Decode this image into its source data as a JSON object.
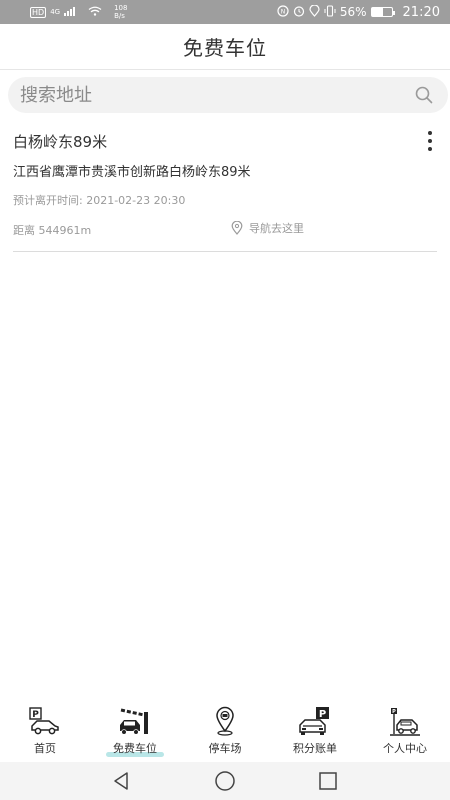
{
  "status_bar": {
    "hd": "HD",
    "network": "4G",
    "speed_value": "108",
    "speed_unit": "B/s",
    "battery": "56%",
    "battery_level": 0.56,
    "time": "21:20"
  },
  "header": {
    "title": "免费车位"
  },
  "search": {
    "placeholder": "搜索地址"
  },
  "card": {
    "title": "白杨岭东89米",
    "address": "江西省鹰潭市贵溪市创新路白杨岭东89米",
    "leave_time": "预计离开时间: 2021-02-23 20:30",
    "distance": "距离  544961m",
    "nav_label": "导航去这里"
  },
  "tabs": [
    {
      "label": "首页",
      "icon": "parking-car-icon"
    },
    {
      "label": "免费车位",
      "icon": "car-barrier-icon",
      "active": true
    },
    {
      "label": "停车场",
      "icon": "map-pin-icon"
    },
    {
      "label": "积分账单",
      "icon": "car-parking-bill-icon"
    },
    {
      "label": "个人中心",
      "icon": "car-garage-icon"
    }
  ],
  "colors": {
    "status_bar": "#9e9e9e",
    "active_underline": "#7fd1d4",
    "search_bg": "#f2f2f2"
  }
}
